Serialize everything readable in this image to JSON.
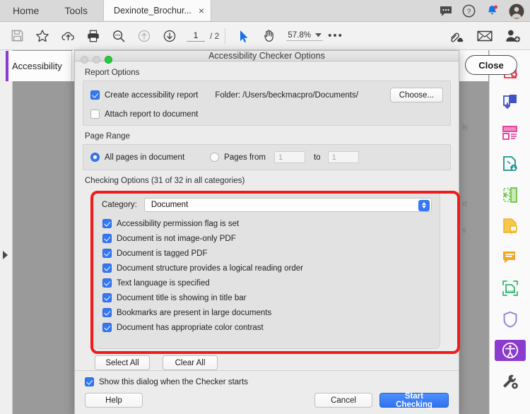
{
  "menubar": {
    "items": [
      {
        "label": "Home",
        "name": "menu-home"
      },
      {
        "label": "Tools",
        "name": "menu-tools"
      }
    ],
    "document_tab": {
      "title": "Dexinote_Brochur...",
      "close": "×"
    },
    "right_icons": [
      {
        "name": "chat-icon",
        "glyph": "comment"
      },
      {
        "name": "help-icon",
        "glyph": "question-circle"
      },
      {
        "name": "notifications-bell-icon",
        "glyph": "bell",
        "badge": true
      },
      {
        "name": "user-avatar",
        "glyph": "avatar"
      }
    ]
  },
  "toolbar": {
    "left_icons": [
      {
        "name": "save-icon",
        "title": "Save"
      },
      {
        "name": "star-icon",
        "title": "Add to favorites"
      },
      {
        "name": "upload-cloud-icon",
        "title": "Upload"
      },
      {
        "name": "print-icon",
        "title": "Print"
      },
      {
        "name": "search-icon",
        "title": "Search"
      },
      {
        "name": "previous-page-icon",
        "title": "Previous page"
      },
      {
        "name": "next-page-icon",
        "title": "Next page"
      }
    ],
    "page_current": "1",
    "page_total": "/ 2",
    "select_tool": "cursor-arrow-icon",
    "hand_tool": "hand-icon",
    "zoom_level": "57.8%",
    "more_label": "•••",
    "right_icons": [
      {
        "name": "share-link-icon",
        "title": "Share"
      },
      {
        "name": "email-icon",
        "title": "Email"
      },
      {
        "name": "add-person-icon",
        "title": "Add person"
      }
    ]
  },
  "left_panel": {
    "accessibility_tab": "Accessibility",
    "expand_arrow": "expand-panel-arrow"
  },
  "document": {
    "close_button": "Close",
    "ghost_fragments": [
      "ls",
      "rt",
      "s"
    ]
  },
  "right_rail": {
    "items": [
      {
        "name": "rail-create-pdf",
        "color": "#e8354a"
      },
      {
        "name": "rail-combine-files",
        "color": "#4053c6"
      },
      {
        "name": "rail-organize-pages",
        "color": "#e0399a"
      },
      {
        "name": "rail-export-pdf",
        "color": "#13948c"
      },
      {
        "name": "rail-edit-pdf",
        "color": "#6ec24a"
      },
      {
        "name": "rail-comment",
        "color": "#f0b323"
      },
      {
        "name": "rail-fill-sign",
        "color": "#f0a81e"
      },
      {
        "name": "rail-scan-ocr",
        "color": "#2fb673"
      },
      {
        "name": "rail-protect",
        "color": "#8a7ddb"
      },
      {
        "name": "rail-accessibility",
        "color": "#8b3bcd",
        "active": true
      },
      {
        "name": "rail-tool-wrench",
        "color": "#4a4a4a"
      }
    ]
  },
  "dialog": {
    "title": "Accessibility Checker Options",
    "traffic_lights": [
      "close-disabled",
      "minimize-disabled",
      "zoom-green"
    ],
    "report_options": {
      "section_label": "Report Options",
      "create_report": {
        "label": "Create accessibility report",
        "checked": true
      },
      "folder_text": "Folder: /Users/beckmacpro/Documents/",
      "choose_button": "Choose...",
      "attach_report": {
        "label": "Attach report to document",
        "checked": false
      }
    },
    "page_range": {
      "section_label": "Page Range",
      "all_pages": {
        "label": "All pages in document",
        "selected": true
      },
      "pages_from": {
        "label": "Pages from",
        "selected": false
      },
      "from_value": "1",
      "to_label": "to",
      "to_value": "1"
    },
    "checking_options": {
      "section_label": "Checking Options (31 of 32 in all categories)",
      "category_label": "Category:",
      "category_value": "Document",
      "highlight_color": "#f01c1c",
      "items": [
        {
          "label": "Accessibility permission flag is set",
          "checked": true
        },
        {
          "label": "Document is not image-only PDF",
          "checked": true
        },
        {
          "label": "Document is tagged PDF",
          "checked": true
        },
        {
          "label": "Document structure provides a logical reading order",
          "checked": true
        },
        {
          "label": "Text language is specified",
          "checked": true
        },
        {
          "label": "Document title is showing in title bar",
          "checked": true
        },
        {
          "label": "Bookmarks are present in large documents",
          "checked": true
        },
        {
          "label": "Document has appropriate color contrast",
          "checked": true
        }
      ],
      "select_all": "Select All",
      "clear_all": "Clear All"
    },
    "footer": {
      "show_dialog": {
        "label": "Show this dialog when the Checker starts",
        "checked": true
      },
      "help": "Help",
      "cancel": "Cancel",
      "start_checking": "Start Checking"
    }
  }
}
